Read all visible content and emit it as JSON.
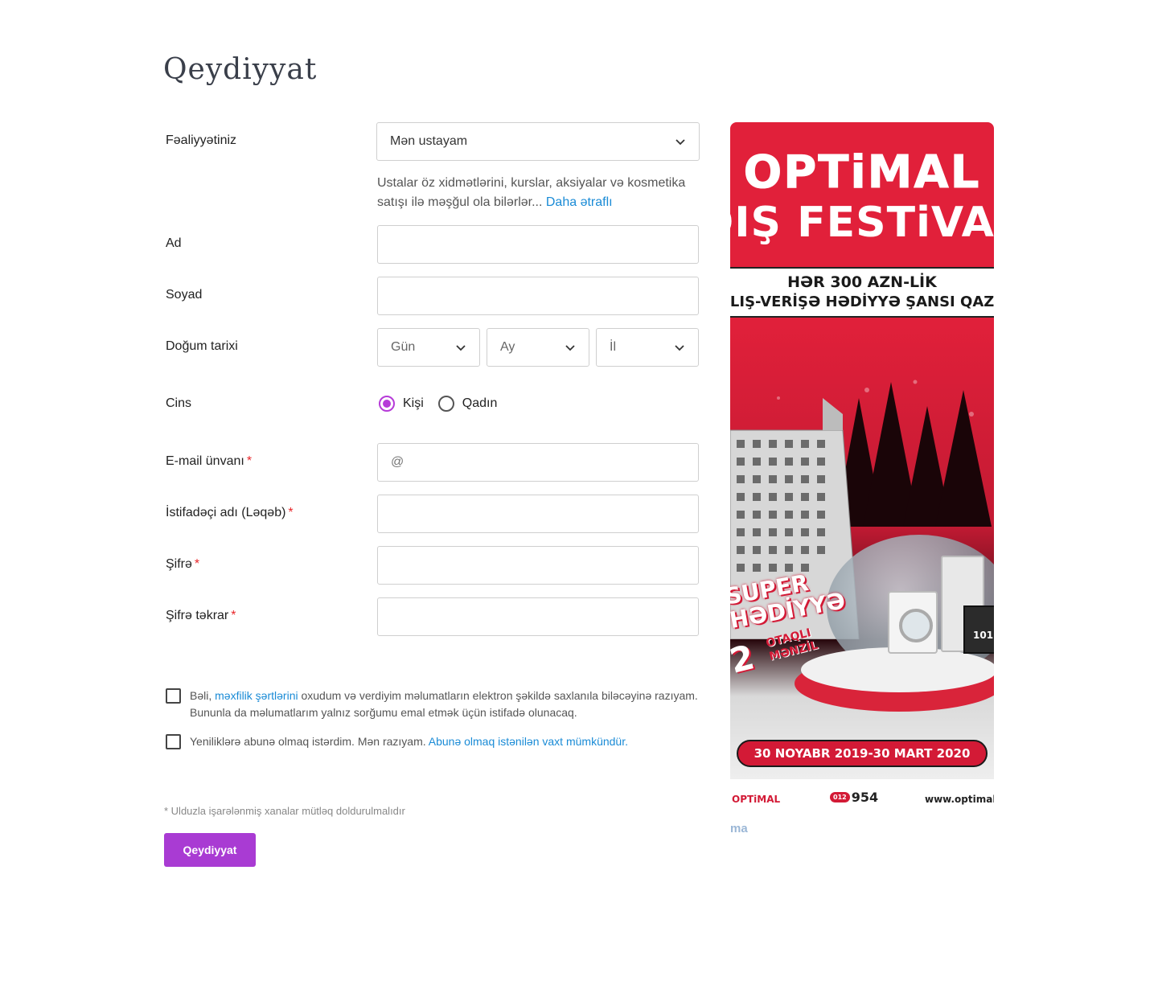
{
  "page": {
    "title": "Qeydiyyat"
  },
  "form": {
    "activity": {
      "label": "Fəaliyyətiniz",
      "selected": "Mən ustayam",
      "hint": "Ustalar öz xidmətlərini, kurslar, aksiyalar və kosmetika satışı ilə məşğul ola bilərlər...",
      "hint_link": "Daha ətraflı"
    },
    "first_name": {
      "label": "Ad",
      "value": ""
    },
    "last_name": {
      "label": "Soyad",
      "value": ""
    },
    "birth_date": {
      "label": "Doğum tarixi",
      "day_placeholder": "Gün",
      "month_placeholder": "Ay",
      "year_placeholder": "İl"
    },
    "gender": {
      "label": "Cins",
      "options": [
        "Kişi",
        "Qadın"
      ],
      "selected": "Kişi"
    },
    "email": {
      "label": "E-mail ünvanı",
      "required_mark": "*",
      "placeholder": "@"
    },
    "username": {
      "label": "İstifadəçi adı (Ləqəb)",
      "required_mark": "*"
    },
    "password": {
      "label": "Şifrə",
      "required_mark": "*"
    },
    "password_repeat": {
      "label": "Şifrə təkrar",
      "required_mark": "*"
    },
    "consent_terms": {
      "prefix": "Bəli,",
      "link": "məxfilik şərtlərini",
      "suffix": "oxudum və verdiyim məlumatların elektron şəkildə saxlanıla biləcəyinə razıyam.",
      "line2": "Bununla da məlumatlarım yalnız sorğumu emal etmək üçün istifadə olunacaq.",
      "checked": false
    },
    "consent_news": {
      "text": "Yeniliklərə abunə olmaq istərdim. Mən razıyam.",
      "link": "Abunə olmaq istənilən vaxt mümkündür.",
      "checked": false
    },
    "footnote": "* Ulduzla işarələnmiş xanalar mütləq doldurulmalıdır",
    "submit_label": "Qeydiyyat"
  },
  "banner": {
    "brand": "OPTiMAL",
    "headline": "QIŞ FESTiVALI",
    "subline1": "HƏR 300 AZN-LİK",
    "subline2": "ALIŞ-VERİŞƏ HƏDİYYƏ ŞANSI QAZAN",
    "super_line1": "SUPER",
    "super_line2": "HƏDİYYƏ",
    "prize_number": "2",
    "prize_line1": "OTAQLI",
    "prize_line2": "MƏNZİL",
    "tv_label": "101",
    "dates": "30 NOYABR 2019-30 MART 2020",
    "footer_brand": "OPTiMAL",
    "footer_phone_prefix": "012",
    "footer_phone": "954",
    "footer_url": "www.optimal.az",
    "tail_text": "ma"
  },
  "colors": {
    "accent": "#a93bd3",
    "link": "#1a8bd6",
    "required": "#e8262a",
    "banner_red": "#e1203a"
  },
  "icons": {
    "dropdown": "chevron-down-icon"
  }
}
